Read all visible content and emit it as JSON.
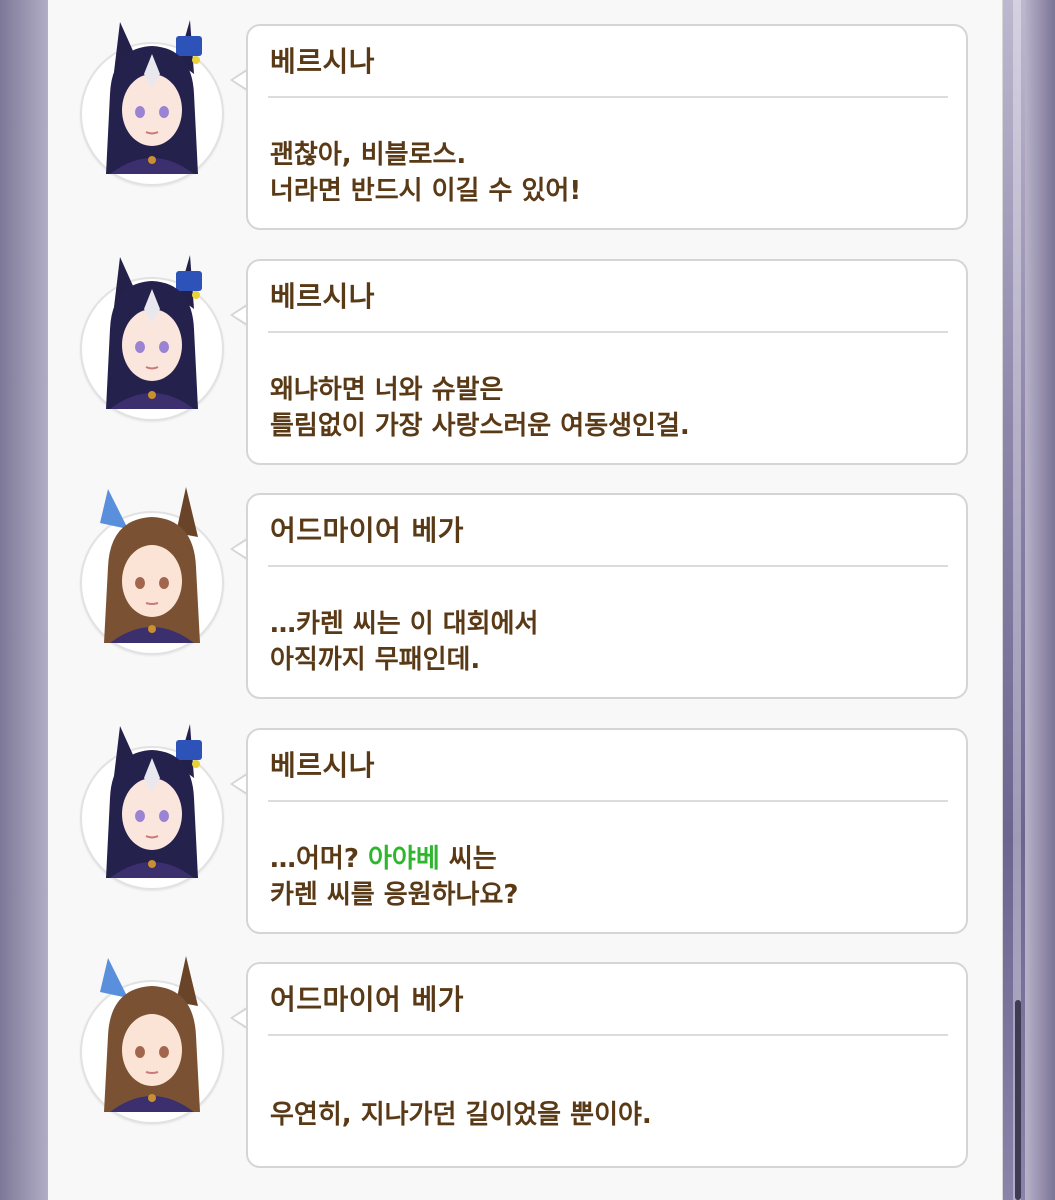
{
  "theme": {
    "text_color": "#5a3a16",
    "highlight_color": "#2eb62e",
    "bubble_border": "#d5d5d5"
  },
  "log": {
    "entries": [
      {
        "speaker": "베르시나",
        "avatar": "dark-haired-horse-girl-portrait",
        "line1": "괜찮아, 비블로스.",
        "line2": "너라면 반드시 이길 수 있어!"
      },
      {
        "speaker": "베르시나",
        "avatar": "dark-haired-horse-girl-portrait",
        "line1": "왜냐하면 너와 슈발은",
        "line2": "틀림없이 가장 사랑스러운 여동생인걸."
      },
      {
        "speaker": "어드마이어 베가",
        "avatar": "brown-haired-horse-girl-portrait",
        "line1": "…카렌 씨는 이 대회에서",
        "line2": "아직까지 무패인데."
      },
      {
        "speaker": "베르시나",
        "avatar": "dark-haired-horse-girl-portrait",
        "line1_prefix": "…어머? ",
        "line1_highlight": "아야베",
        "line1_suffix": " 씨는",
        "line2": "카렌 씨를 응원하나요?"
      },
      {
        "speaker": "어드마이어 베가",
        "avatar": "brown-haired-horse-girl-portrait",
        "line1": "우연히, 지나가던 길이었을 뿐이야."
      }
    ]
  }
}
